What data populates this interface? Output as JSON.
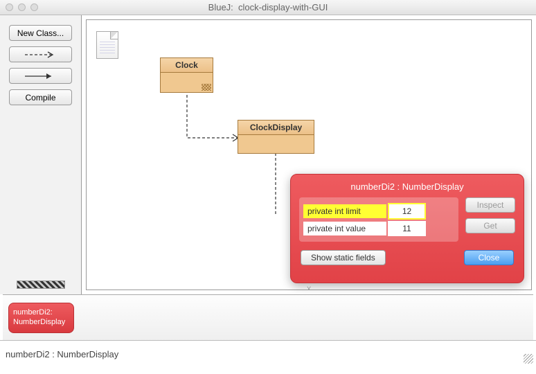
{
  "window": {
    "app": "BlueJ:",
    "project": "clock-display-with-GUI"
  },
  "sidebar": {
    "new_class": "New Class...",
    "compile": "Compile"
  },
  "classes": {
    "clock": "Clock",
    "display": "ClockDisplay"
  },
  "inspector": {
    "title": "numberDi2 : NumberDisplay",
    "fields": [
      {
        "label": "private int limit",
        "value": "12",
        "highlight": true
      },
      {
        "label": "private int value",
        "value": "11",
        "highlight": false
      }
    ],
    "inspect_btn": "Inspect",
    "get_btn": "Get",
    "show_static": "Show static fields",
    "close": "Close"
  },
  "object_bench": {
    "chip_line1": "numberDi2:",
    "chip_line2": "NumberDisplay"
  },
  "status": "numberDi2 : NumberDisplay"
}
